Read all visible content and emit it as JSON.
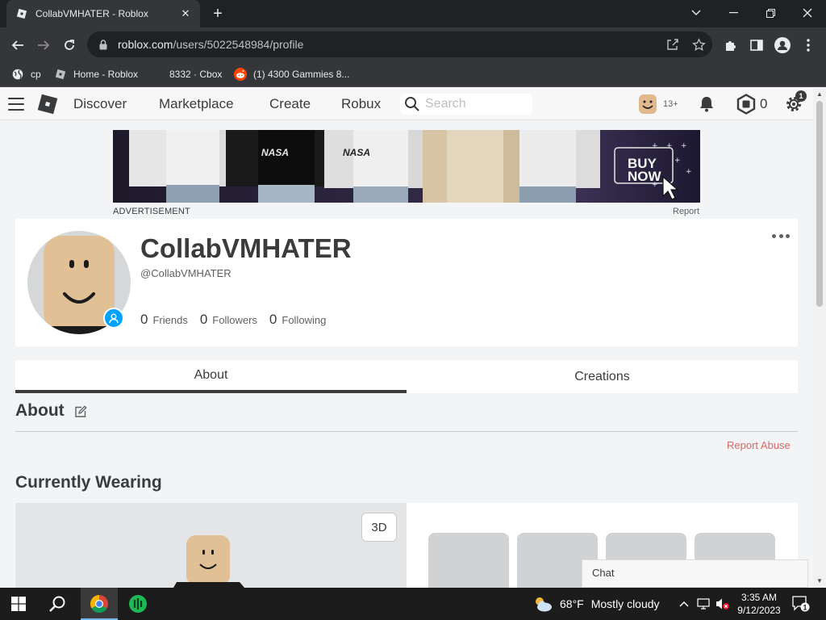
{
  "browser": {
    "tab_title": "CollabVMHATER - Roblox",
    "new_tab_symbol": "+",
    "url_host": "roblox.com",
    "url_path": "/users/5022548984/profile",
    "bookmarks": [
      "cp",
      "Home - Roblox",
      "8332 · Cbox",
      "(1) 4300 Gammies 8..."
    ]
  },
  "header": {
    "nav": [
      "Discover",
      "Marketplace",
      "Create",
      "Robux"
    ],
    "search_placeholder": "Search",
    "age_label": "13+",
    "robux": "0",
    "notifications": "1"
  },
  "ad": {
    "label": "ADVERTISEMENT",
    "report": "Report",
    "cta": [
      "BUY",
      "NOW"
    ],
    "print_text": "NASA"
  },
  "profile": {
    "display_name": "CollabVMHATER",
    "username": "@CollabVMHATER",
    "stats": [
      {
        "count": "0",
        "label": "Friends"
      },
      {
        "count": "0",
        "label": "Followers"
      },
      {
        "count": "0",
        "label": "Following"
      }
    ]
  },
  "tabs": [
    "About",
    "Creations"
  ],
  "about": {
    "title": "About",
    "report_abuse": "Report Abuse"
  },
  "wearing": {
    "title": "Currently Wearing",
    "view_3d": "3D"
  },
  "chat": {
    "label": "Chat"
  },
  "taskbar": {
    "temperature": "68°F",
    "weather": "Mostly cloudy",
    "time": "3:35 AM",
    "date": "9/12/2023",
    "notification_count": "1"
  },
  "colors": {
    "roblox_blue": "#00a2ff",
    "report_red": "#d86868",
    "chrome_dark": "#202124"
  }
}
